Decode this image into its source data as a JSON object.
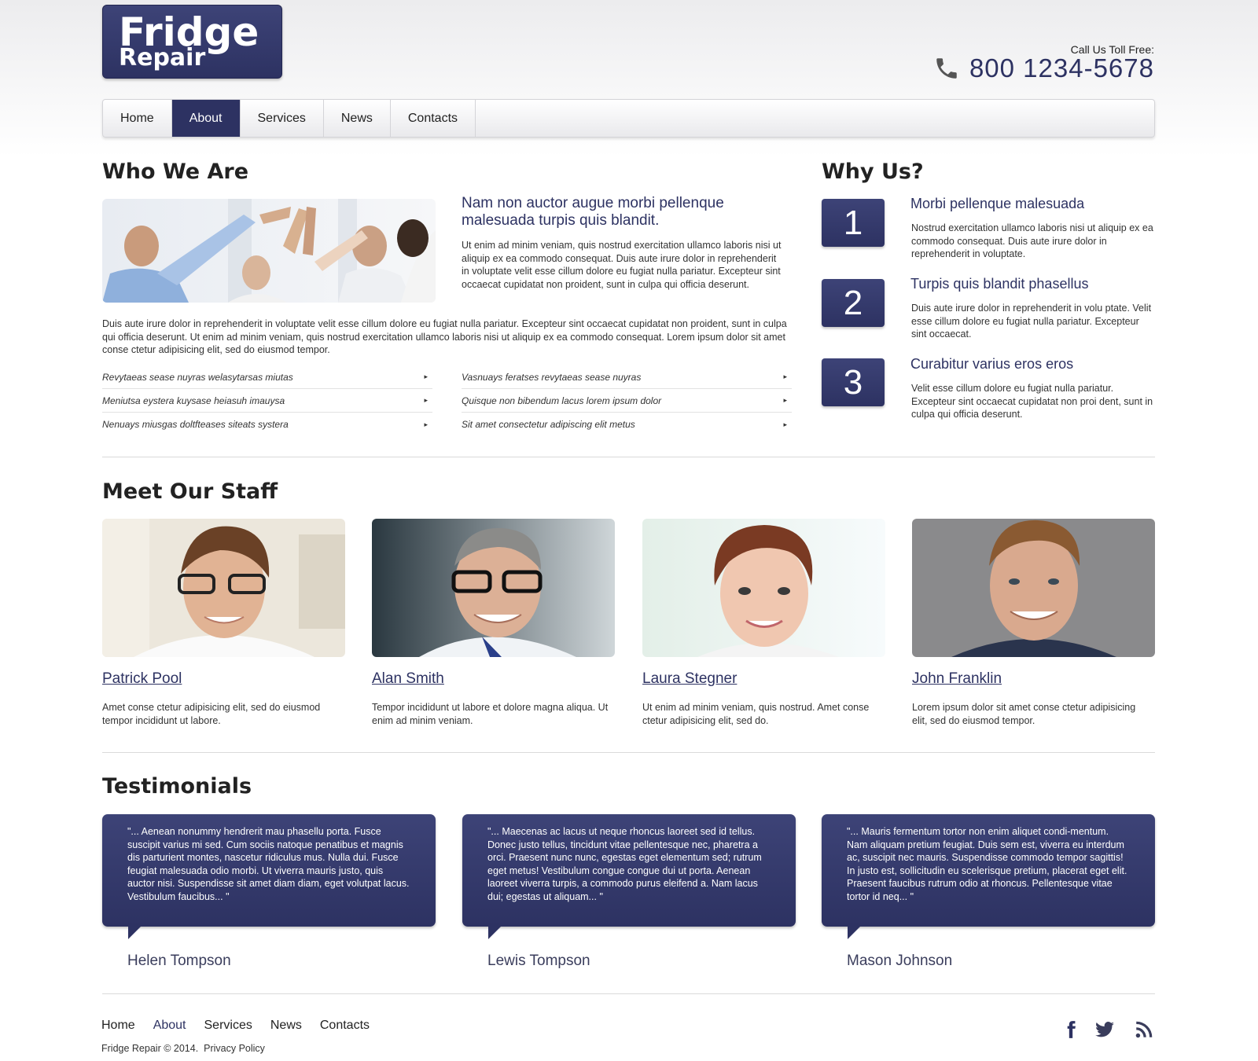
{
  "header": {
    "logo_line1": "Fridge",
    "logo_line2": "Repair",
    "call_label": "Call Us Toll Free:",
    "phone": "800 1234-5678"
  },
  "nav": {
    "items": [
      "Home",
      "About",
      "Services",
      "News",
      "Contacts"
    ],
    "active": "About"
  },
  "who": {
    "title": "Who We Are",
    "lead_title": "Nam non auctor augue morbi pellenque malesuada turpis quis blandit.",
    "lead_text": "Ut enim ad minim veniam, quis nostrud exercitation ullamco laboris nisi ut aliquip ex ea commodo consequat. Duis aute irure dolor in reprehenderit in voluptate velit esse cillum dolore eu fugiat nulla pariatur. Excepteur sint occaecat cupidatat non proident, sunt in culpa qui officia deserunt.",
    "paragraph": "Duis aute irure dolor in reprehenderit in voluptate velit esse cillum dolore eu fugiat nulla pariatur. Excepteur sint occaecat cupidatat non proident, sunt in culpa qui officia deserunt. Ut enim ad minim veniam, quis nostrud exercitation ullamco laboris nisi ut aliquip ex ea commodo consequat. Lorem ipsum dolor sit amet conse ctetur adipisicing elit, sed do eiusmod tempor.",
    "list_left": [
      "Revytaeas sease nuyras welasytarsas miutas",
      "Meniutsa eystera kuysase heiasuh imauysa",
      "Nenuays miusgas doltfteases siteats systera"
    ],
    "list_right": [
      "Vasnuays feratses revytaeas sease nuyras",
      "Quisque non bibendum lacus lorem ipsum dolor",
      "Sit amet consectetur adipiscing elit metus"
    ],
    "arrow": "▸"
  },
  "why": {
    "title": "Why Us?",
    "items": [
      {
        "num": "1",
        "title": "Morbi pellenque malesuada",
        "text": "Nostrud exercitation ullamco laboris nisi ut aliquip ex ea commodo consequat. Duis aute irure dolor in reprehenderit in voluptate."
      },
      {
        "num": "2",
        "title": "Turpis quis blandit phasellus",
        "text": "Duis aute irure dolor in reprehenderit in volu ptate. Velit esse cillum dolore eu fugiat nulla pariatur. Excepteur sint occaecat."
      },
      {
        "num": "3",
        "title": "Curabitur varius eros eros",
        "text": "Velit esse cillum dolore eu fugiat nulla pariatur. Excepteur sint occaecat cupidatat non proi dent, sunt in culpa qui officia deserunt."
      }
    ]
  },
  "staff": {
    "title": "Meet Our Staff",
    "members": [
      {
        "name": "Patrick Pool",
        "desc": "Amet conse ctetur adipisicing elit, sed do eiusmod tempor incididunt ut labore."
      },
      {
        "name": "Alan Smith",
        "desc": "Tempor incididunt ut labore et dolore magna aliqua. Ut enim ad minim veniam."
      },
      {
        "name": "Laura Stegner",
        "desc": "Ut enim ad minim veniam, quis nostrud. Amet conse ctetur adipisicing elit, sed do."
      },
      {
        "name": "John Franklin",
        "desc": "Lorem ipsum dolor sit amet conse ctetur adipisicing elit, sed do eiusmod tempor."
      }
    ]
  },
  "testimonials": {
    "title": "Testimonials",
    "items": [
      {
        "quote": "\"... Aenean nonummy hendrerit mau phasellu porta. Fusce suscipit varius mi sed. Cum sociis natoque penatibus et magnis dis parturient montes, nascetur ridiculus mus. Nulla dui. Fusce feugiat malesuada odio morbi. Ut viverra mauris justo, quis auctor nisi. Suspendisse sit amet diam diam, eget volutpat lacus. Vestibulum faucibus... \"",
        "name": "Helen Tompson"
      },
      {
        "quote": "\"... Maecenas ac lacus ut neque rhoncus laoreet sed id tellus. Donec justo tellus, tincidunt vitae pellentesque nec, pharetra a orci. Praesent nunc nunc, egestas eget elementum sed; rutrum eget metus! Vestibulum congue congue dui ut porta. Aenean laoreet viverra turpis, a commodo purus eleifend a. Nam lacus dui; egestas ut aliquam... \"",
        "name": "Lewis Tompson"
      },
      {
        "quote": "\"... Mauris fermentum tortor non enim aliquet condi-mentum. Nam aliquam pretium feugiat. Duis sem est, viverra eu interdum ac, suscipit nec mauris. Suspendisse commodo tempor sagittis! In justo est, sollicitudin eu scelerisque pretium, placerat eget elit. Praesent faucibus rutrum odio at rhoncus. Pellentesque vitae tortor id neq... \"",
        "name": "Mason Johnson"
      }
    ]
  },
  "footer": {
    "nav": [
      "Home",
      "About",
      "Services",
      "News",
      "Contacts"
    ],
    "copyright": "Fridge  Repair © 2014.",
    "privacy": "Privacy Policy",
    "social_icons": [
      "facebook-icon",
      "twitter-icon",
      "rss-icon"
    ]
  },
  "colors": {
    "brand": "#2d3262",
    "brand_light": "#3d4377",
    "text": "#333333"
  }
}
